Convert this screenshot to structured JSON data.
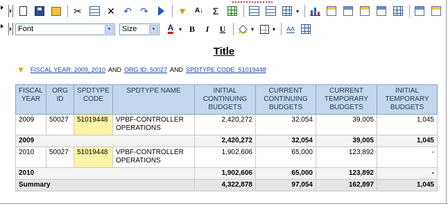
{
  "toolbar": {
    "glyphs": {
      "cut": "✂",
      "delete": "✕",
      "undo": "↶",
      "redo": "↷",
      "filter": "▼",
      "sort": "A↓",
      "sigma": "Σ",
      "dropdown": "▾"
    }
  },
  "format_toolbar": {
    "font_value": "Font",
    "size_value": "Size",
    "font_color_glyph": "A",
    "bold": "B",
    "italic": "I",
    "underline": "U",
    "aa_glyph": "AA"
  },
  "report": {
    "title": "Title",
    "filter": {
      "fiscal_year": "FISCAL YEAR: 2009, 2010",
      "and1": "AND",
      "org_id": "ORG ID: 50027",
      "and2": "AND",
      "spdtype_code": "SPDTYPE CODE: 51019448"
    },
    "columns": [
      "FISCAL YEAR",
      "ORG ID",
      "SPDTYPE CODE",
      "SPDTYPE NAME",
      "INITIAL CONTINUING BUDGETS",
      "CURRENT CONTINUING BUDGETS",
      "CURRENT TEMPORARY BUDGETS",
      "INITIAL TEMPORARY BUDGETS"
    ],
    "rows": [
      {
        "type": "data",
        "cells": [
          "2009",
          "50027",
          "51019448",
          "VPBF-CONTROLLER OPERATIONS",
          "2,420,272",
          "32,054",
          "39,005",
          "1,045"
        ]
      },
      {
        "type": "subtotal",
        "label": "2009",
        "values": [
          "2,420,272",
          "32,054",
          "39,005",
          "1,045"
        ]
      },
      {
        "type": "data",
        "cells": [
          "2010",
          "50027",
          "51019448",
          "VPBF-CONTROLLER OPERATIONS",
          "1,902,606",
          "65,000",
          "123,892",
          "-"
        ]
      },
      {
        "type": "subtotal",
        "label": "2010",
        "values": [
          "1,902,606",
          "65,000",
          "123,892",
          "-"
        ]
      },
      {
        "type": "summary",
        "label": "Summary",
        "values": [
          "4,322,878",
          "97,054",
          "162,897",
          "1,045"
        ]
      }
    ]
  },
  "colors": {
    "header_bg": "#c4d6ea",
    "highlight_cell": "#fbf3a6",
    "link": "#1a3fb5"
  }
}
